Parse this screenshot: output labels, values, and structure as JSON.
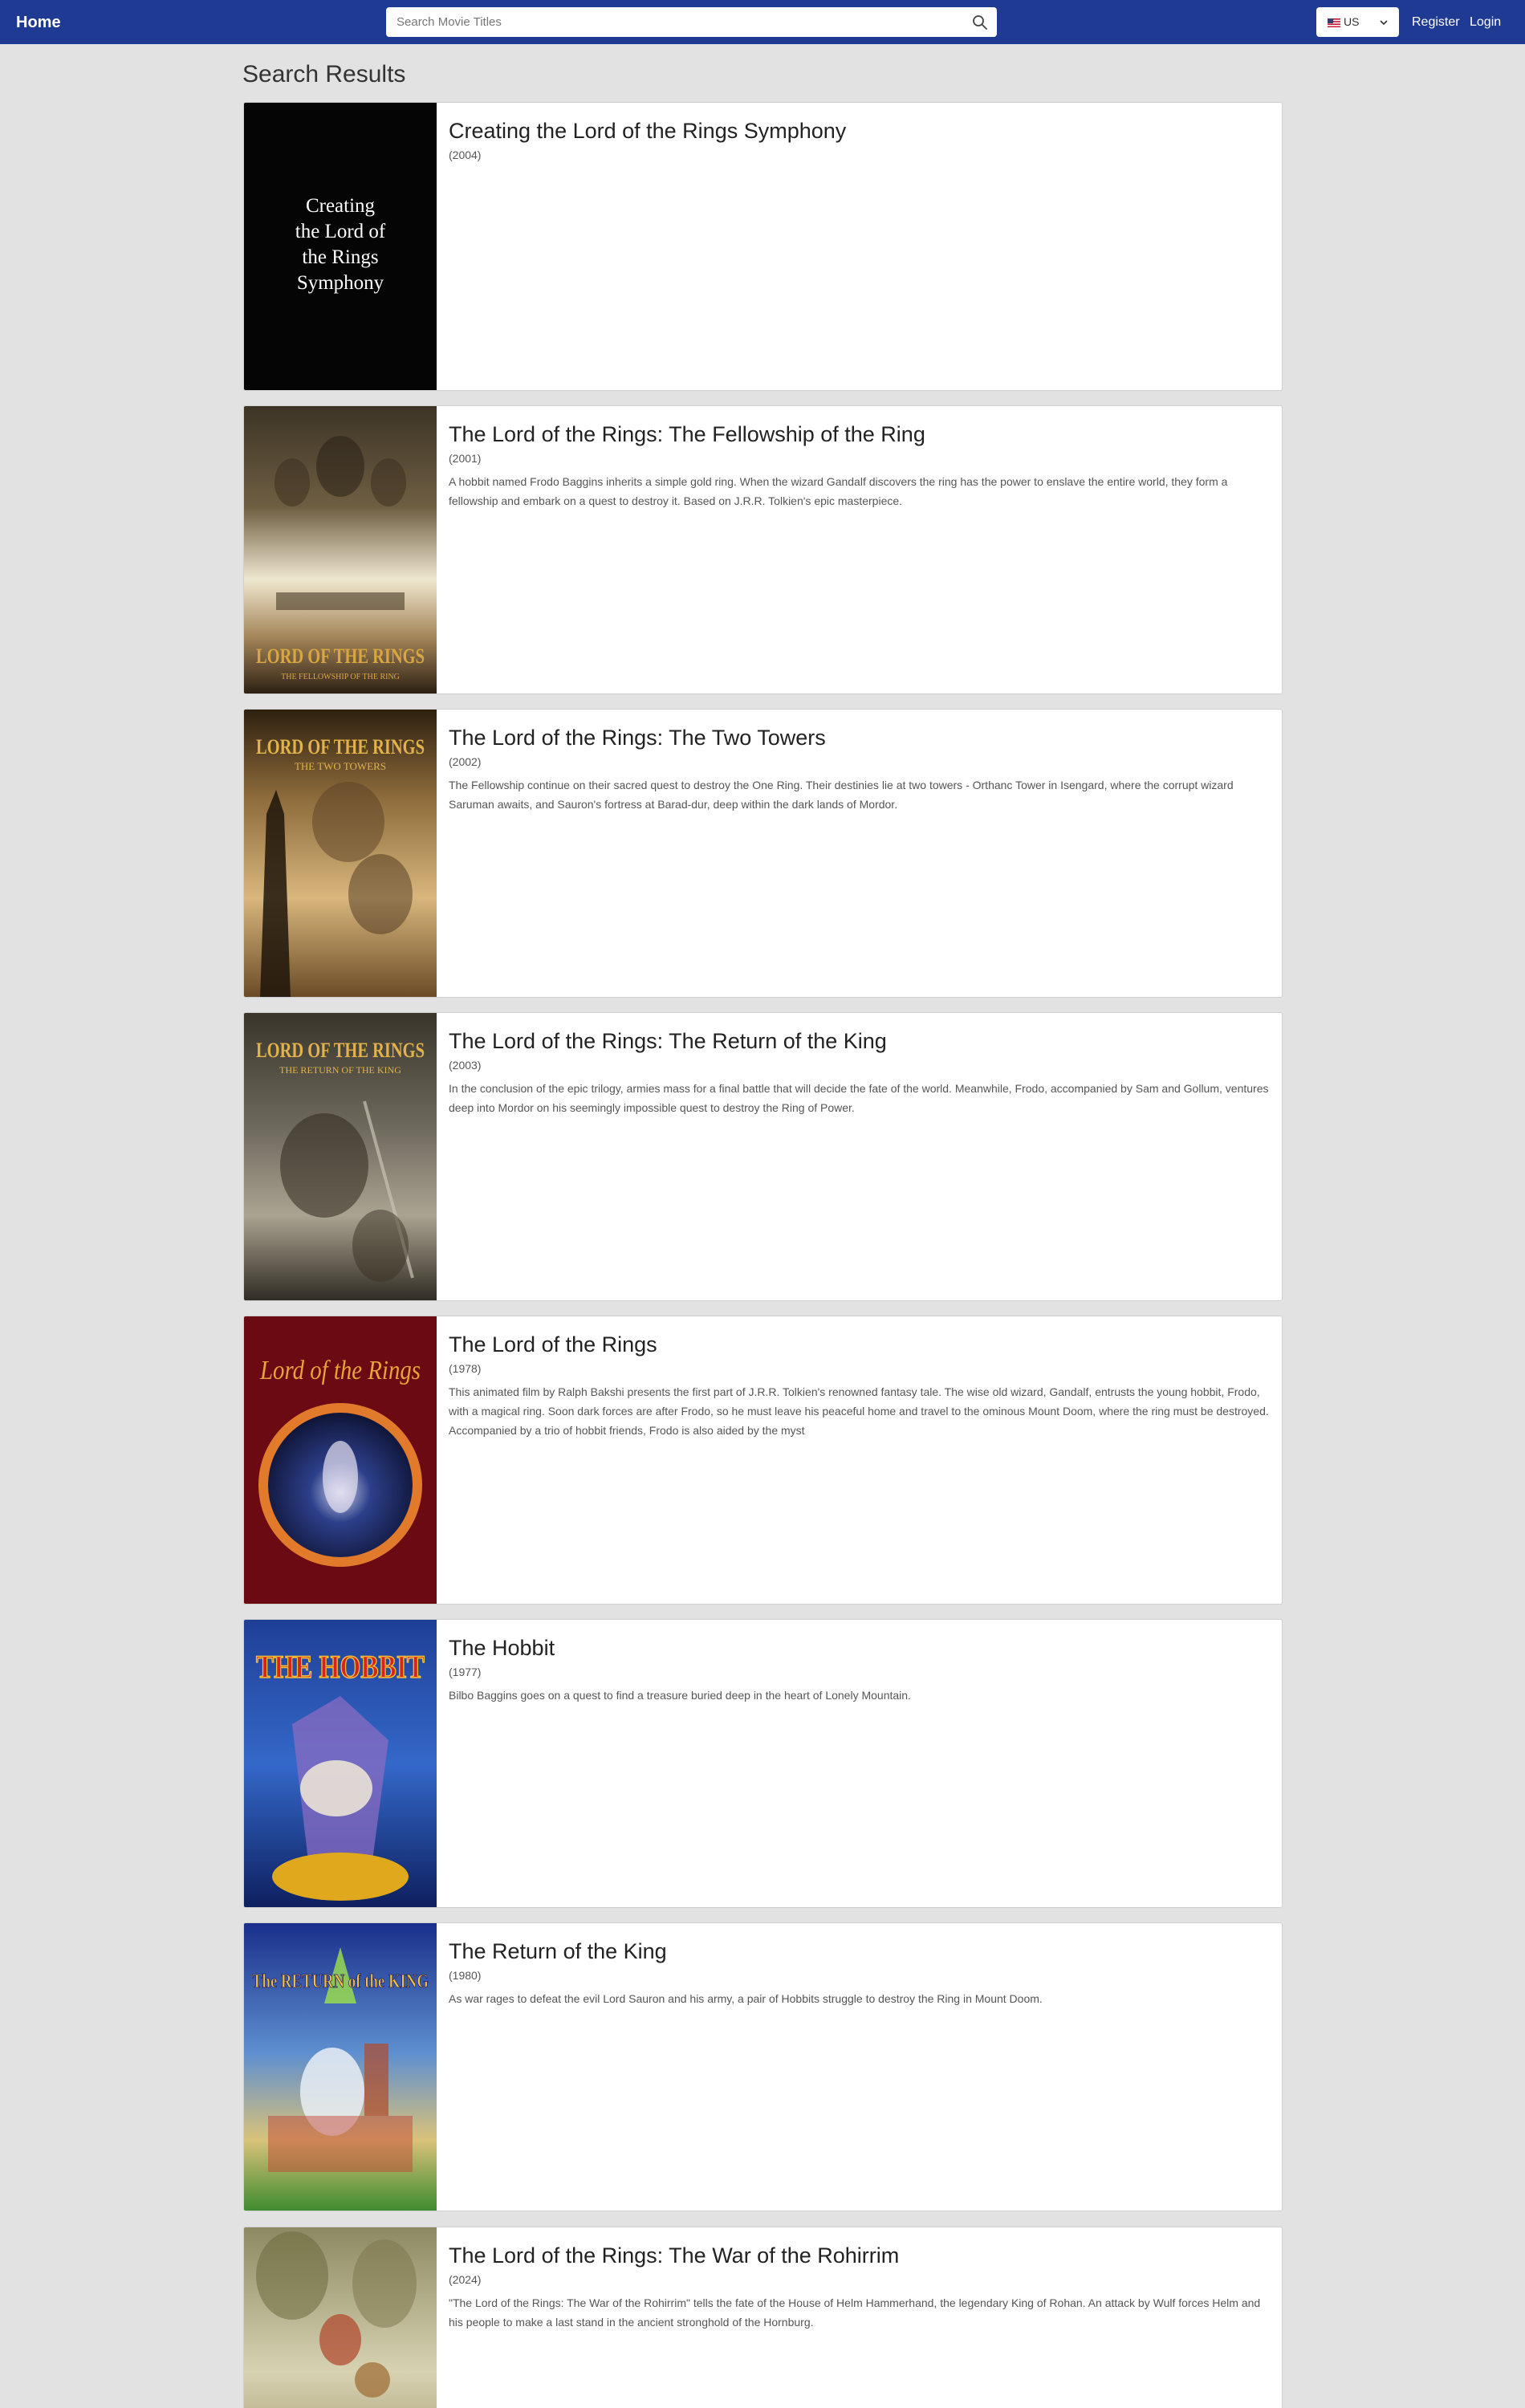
{
  "nav": {
    "home_label": "Home",
    "search_placeholder": "Search Movie Titles",
    "country_label": "US",
    "register_label": "Register",
    "login_label": "Login"
  },
  "page": {
    "heading": "Search Results"
  },
  "results": [
    {
      "title": "Creating the Lord of the Rings Symphony",
      "year": "(2004)",
      "overview": "",
      "poster_text": [
        "Creating",
        "the Lord of",
        "the Rings",
        "Symphony"
      ]
    },
    {
      "title": "The Lord of the Rings: The Fellowship of the Ring",
      "year": "(2001)",
      "overview": "A hobbit named Frodo Baggins inherits a simple gold ring. When the wizard Gandalf discovers the ring has the power to enslave the entire world, they form a fellowship and embark on a quest to destroy it. Based on J.R.R. Tolkien's epic masterpiece.",
      "poster_logo": "LORD OF THE RINGS",
      "poster_subtitle": "THE FELLOWSHIP OF THE RING"
    },
    {
      "title": "The Lord of the Rings: The Two Towers",
      "year": "(2002)",
      "overview": "The Fellowship continue on their sacred quest to destroy the One Ring. Their destinies lie at two towers - Orthanc Tower in Isengard, where the corrupt wizard Saruman awaits, and Sauron's fortress at Barad-dur, deep within the dark lands of Mordor.",
      "poster_logo": "LORD OF THE RINGS",
      "poster_subtitle": "THE TWO TOWERS"
    },
    {
      "title": "The Lord of the Rings: The Return of the King",
      "year": "(2003)",
      "overview": "In the conclusion of the epic trilogy, armies mass for a final battle that will decide the fate of the world. Meanwhile, Frodo, accompanied by Sam and Gollum, ventures deep into Mordor on his seemingly impossible quest to destroy the Ring of Power.",
      "poster_logo": "LORD OF THE RINGS",
      "poster_subtitle": "THE RETURN OF THE KING"
    },
    {
      "title": "The Lord of the Rings",
      "year": "(1978)",
      "overview": "This animated film by Ralph Bakshi presents the first part of J.R.R. Tolkien's renowned fantasy tale. The wise old wizard, Gandalf, entrusts the young hobbit, Frodo, with a magical ring. Soon dark forces are after Frodo, so he must leave his peaceful home and travel to the ominous Mount Doom, where the ring must be destroyed. Accompanied by a trio of hobbit friends, Frodo is also aided by the myst",
      "poster_logo": "Lord of the Rings"
    },
    {
      "title": "The Hobbit",
      "year": "(1977)",
      "overview": "Bilbo Baggins goes on a quest to find a treasure buried deep in the heart of Lonely Mountain.",
      "poster_logo": "THE HOBBIT"
    },
    {
      "title": "The Return of the King",
      "year": "(1980)",
      "overview": "As war rages to defeat the evil Lord Sauron and his army, a pair of Hobbits struggle to destroy the Ring in Mount Doom.",
      "poster_logo": "The RETURN of the KING"
    },
    {
      "title": "The Lord of the Rings: The War of the Rohirrim",
      "year": "(2024)",
      "overview": "\"The Lord of the Rings: The War of the Rohirrim\" tells the fate of the House of Helm Hammerhand, the legendary King of Rohan. An attack by Wulf forces Helm and his people to make a last stand in the ancient stronghold of the Hornburg."
    }
  ]
}
